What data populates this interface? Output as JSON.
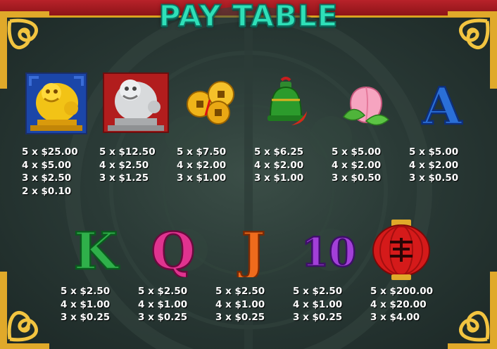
{
  "title": "PAY TABLE",
  "colors": {
    "title": "#2ee0b8",
    "frame_gold": "#e0a92a",
    "top_bar": "#b8222a",
    "payout_text": "#ffffff"
  },
  "symbols": [
    {
      "name": "gold-lion",
      "icon": "gold-foo-dog-icon",
      "payouts": [
        "5 x $25.00",
        "4 x $5.00",
        "3 x $2.50",
        "2 x $0.10"
      ]
    },
    {
      "name": "silver-lion",
      "icon": "silver-foo-dog-icon",
      "payouts": [
        "5 x $12.50",
        "4 x $2.50",
        "3 x $1.25"
      ]
    },
    {
      "name": "coins",
      "icon": "gold-coins-icon",
      "payouts": [
        "5 x $7.50",
        "4 x $2.00",
        "3 x $1.00"
      ]
    },
    {
      "name": "bell",
      "icon": "green-bell-icon",
      "payouts": [
        "5 x $6.25",
        "4 x $2.00",
        "3 x $1.00"
      ]
    },
    {
      "name": "peach",
      "icon": "peach-icon",
      "payouts": [
        "5 x $5.00",
        "4 x $2.00",
        "3 x $0.50"
      ]
    },
    {
      "name": "A",
      "icon": "letter-a-icon",
      "label": "A",
      "payouts": [
        "5 x $5.00",
        "4 x $2.00",
        "3 x $0.50"
      ]
    },
    {
      "name": "K",
      "icon": "letter-k-icon",
      "label": "K",
      "payouts": [
        "5 x $2.50",
        "4 x $1.00",
        "3 x $0.25"
      ]
    },
    {
      "name": "Q",
      "icon": "letter-q-icon",
      "label": "Q",
      "payouts": [
        "5 x $2.50",
        "4 x $1.00",
        "3 x $0.25"
      ]
    },
    {
      "name": "J",
      "icon": "letter-j-icon",
      "label": "J",
      "payouts": [
        "5 x $2.50",
        "4 x $1.00",
        "3 x $0.25"
      ]
    },
    {
      "name": "10",
      "icon": "number-ten-icon",
      "label": "10",
      "payouts": [
        "5 x $2.50",
        "4 x $1.00",
        "3 x $0.25"
      ]
    },
    {
      "name": "lantern",
      "icon": "red-lantern-icon",
      "payouts": [
        "5 x $200.00",
        "4 x $20.00",
        "3 x $4.00"
      ]
    }
  ]
}
